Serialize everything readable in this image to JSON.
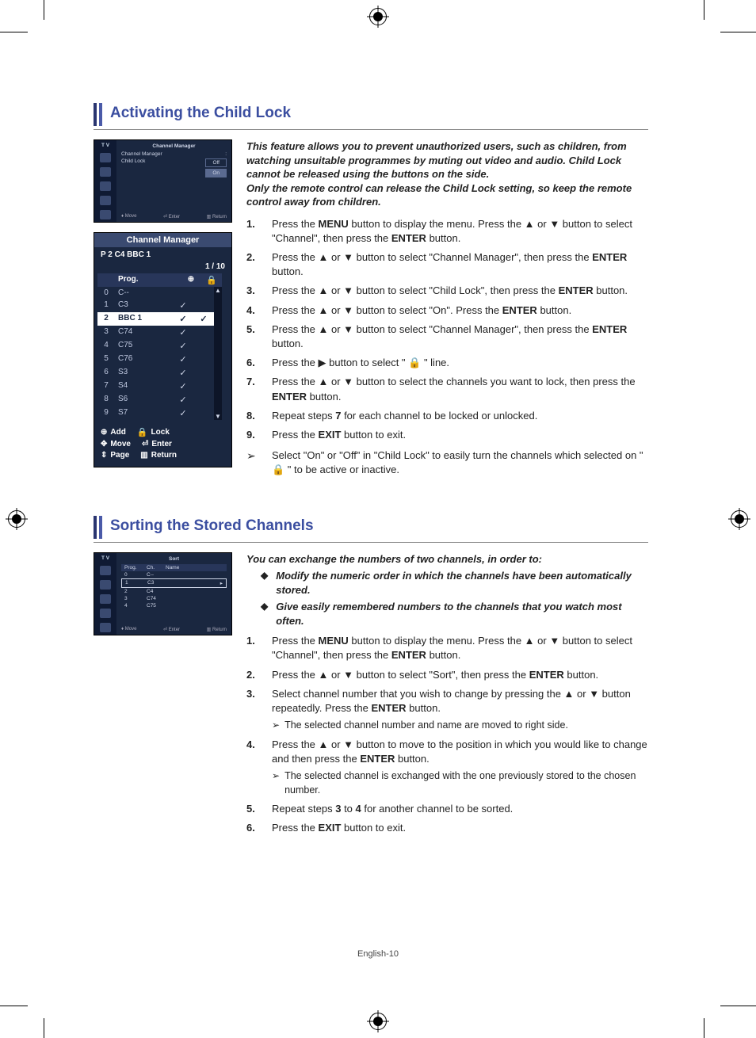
{
  "page_footer": "English-10",
  "section1": {
    "title": "Activating the Child Lock",
    "intro": "This feature allows you to prevent unauthorized users, such as children, from watching unsuitable programmes by muting out video and audio. Child Lock cannot be released using the buttons on the side.\nOnly the remote control can release the Child Lock setting, so keep the remote control away from children.",
    "osd_small": {
      "tv_label": "T V",
      "header": "Channel Manager",
      "row1_label": "Channel Manager",
      "row1_sep": ":",
      "row2_label": "Child Lock",
      "row2_sep": ":",
      "opt_off": "Off",
      "opt_on": "On",
      "f_move": "Move",
      "f_enter": "Enter",
      "f_return": "Return"
    },
    "osd_big": {
      "title": "Channel Manager",
      "status": "P  2   C4        BBC 1",
      "pages": "1 / 10",
      "head_prog": "Prog.",
      "rows": [
        {
          "n": "0",
          "name": "C--",
          "add": "",
          "lock": ""
        },
        {
          "n": "1",
          "name": "C3",
          "add": "✓",
          "lock": ""
        },
        {
          "n": "2",
          "name": "BBC 1",
          "add": "✓",
          "lock": "✓",
          "sel": true
        },
        {
          "n": "3",
          "name": "C74",
          "add": "✓",
          "lock": ""
        },
        {
          "n": "4",
          "name": "C75",
          "add": "✓",
          "lock": ""
        },
        {
          "n": "5",
          "name": "C76",
          "add": "✓",
          "lock": ""
        },
        {
          "n": "6",
          "name": "S3",
          "add": "✓",
          "lock": ""
        },
        {
          "n": "7",
          "name": "S4",
          "add": "✓",
          "lock": ""
        },
        {
          "n": "8",
          "name": "S6",
          "add": "✓",
          "lock": ""
        },
        {
          "n": "9",
          "name": "S7",
          "add": "✓",
          "lock": ""
        }
      ],
      "legend": {
        "add": "Add",
        "lock": "Lock",
        "move": "Move",
        "enter": "Enter",
        "page": "Page",
        "return": "Return"
      }
    },
    "steps": [
      {
        "n": "1.",
        "pre": "Press the ",
        "b1": "MENU",
        "mid1": " button to display the menu.  Press the  ▲  or  ▼  button to select \"Channel\", then press the ",
        "b2": "ENTER",
        "post": " button."
      },
      {
        "n": "2.",
        "pre": "Press the  ▲  or  ▼  button to select \"Channel Manager\", then press the ",
        "b1": "ENTER",
        "post": " button."
      },
      {
        "n": "3.",
        "pre": "Press the  ▲  or  ▼  button to select \"Child Lock\",  then press the ",
        "b1": "ENTER",
        "post": " button."
      },
      {
        "n": "4.",
        "pre": "Press the  ▲  or  ▼  button to select \"On\". Press the ",
        "b1": "ENTER",
        "post": " button."
      },
      {
        "n": "5.",
        "pre": "Press the  ▲  or  ▼  button to select \"Channel Manager\",  then press the ",
        "b1": "ENTER",
        "post": " button."
      },
      {
        "n": "6.",
        "pre": "Press the  ▶  button to select \" 🔒 \" line.",
        "b1": "",
        "post": ""
      },
      {
        "n": "7.",
        "pre": "Press the  ▲  or  ▼   button to select the channels you want to lock, then press the ",
        "b1": "ENTER",
        "post": " button."
      },
      {
        "n": "8.",
        "pre": "Repeat steps ",
        "b1": "7",
        "post": " for each channel to be locked or unlocked."
      },
      {
        "n": "9.",
        "pre": "Press the ",
        "b1": "EXIT",
        "post": " button to exit."
      }
    ],
    "note": "Select \"On\" or \"Off\" in \"Child Lock\" to easily turn the channels which selected on \" 🔒 \" to be active or inactive."
  },
  "section2": {
    "title": "Sorting the Stored Channels",
    "intro": "You can exchange the numbers of two channels, in order to:",
    "bullets": [
      "Modify the numeric order in which the channels have been automatically stored.",
      "Give easily remembered numbers to the channels that you watch most often."
    ],
    "osd_small": {
      "tv_label": "T V",
      "header": "Sort",
      "h_prog": "Prog.",
      "h_ch": "Ch.",
      "h_name": "Name",
      "rows": [
        {
          "p": "0",
          "c": "C--",
          "n": ""
        },
        {
          "p": "1",
          "c": "C3",
          "n": "",
          "sel": true
        },
        {
          "p": "2",
          "c": "C4",
          "n": ""
        },
        {
          "p": "3",
          "c": "C74",
          "n": ""
        },
        {
          "p": "4",
          "c": "C75",
          "n": ""
        }
      ],
      "f_move": "Move",
      "f_enter": "Enter",
      "f_return": "Return"
    },
    "steps": [
      {
        "n": "1.",
        "pre": "Press the ",
        "b1": "MENU",
        "mid1": " button to display the menu.  Press the  ▲  or  ▼  button to select \"Channel\", then press the ",
        "b2": "ENTER",
        "post": " button."
      },
      {
        "n": "2.",
        "pre": "Press the  ▲  or  ▼  button to select \"Sort\", then press the ",
        "b1": "ENTER",
        "post": " button."
      },
      {
        "n": "3.",
        "pre": "Select channel number that you wish to change by pressing the  ▲  or  ▼  button repeatedly. Press the ",
        "b1": "ENTER",
        "post": " button.",
        "sub": "The selected channel number and name are moved to right side."
      },
      {
        "n": "4.",
        "pre": "Press the  ▲  or  ▼  button to move to the position in which you would like to change  and then press the  ",
        "b1": "ENTER",
        "post": " button.",
        "sub": "The selected channel is exchanged with the one previously stored to the chosen number."
      },
      {
        "n": "5.",
        "pre": "Repeat steps ",
        "b1": "3",
        "mid1": " to ",
        "b2": "4",
        "post": " for another channel to be sorted."
      },
      {
        "n": "6.",
        "pre": "Press the ",
        "b1": "EXIT",
        "post": " button to exit."
      }
    ]
  }
}
